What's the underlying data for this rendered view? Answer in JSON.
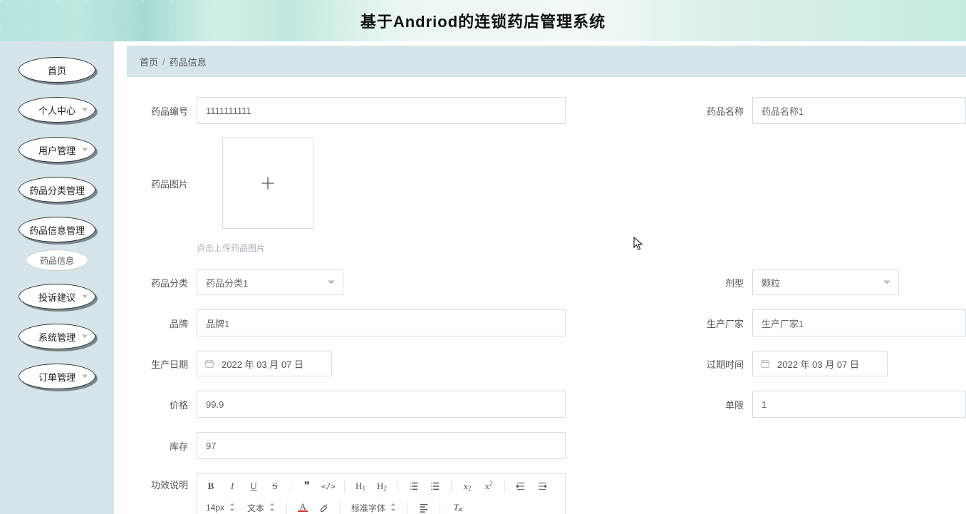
{
  "header": {
    "title": "基于Andriod的连锁药店管理系统"
  },
  "sidebar": {
    "items": [
      {
        "label": "首页",
        "caret": false
      },
      {
        "label": "个人中心",
        "caret": true
      },
      {
        "label": "用户管理",
        "caret": true
      },
      {
        "label": "药品分类管理",
        "caret": false
      },
      {
        "label": "药品信息管理",
        "caret": false
      },
      {
        "label": "投诉建议",
        "caret": true
      },
      {
        "label": "系统管理",
        "caret": true
      },
      {
        "label": "订单管理",
        "caret": true
      }
    ],
    "sublabel": "药品信息"
  },
  "breadcrumb": {
    "home": "首页",
    "sep": "/",
    "current": "药品信息"
  },
  "form": {
    "labels": {
      "code": "药品编号",
      "name": "药品名称",
      "image": "药品图片",
      "uploadHint": "点击上传药品图片",
      "category": "药品分类",
      "dosage": "剂型",
      "brand": "品牌",
      "manufacturer": "生产厂家",
      "produceDate": "生产日期",
      "expireDate": "过期时间",
      "price": "价格",
      "limit": "单限",
      "stock": "库存",
      "efficacy": "功效说明"
    },
    "values": {
      "code": "1111111111",
      "name": "药品名称1",
      "category": "药品分类1",
      "dosage": "颗粒",
      "brand": "品牌1",
      "manufacturer": "生产厂家1",
      "produceDate": "2022 年 03 月 07 日",
      "expireDate": "2022 年 03 月 07 日",
      "price": "99.9",
      "limit": "1",
      "stock": "97"
    }
  },
  "rte": {
    "fontSize": "14px",
    "fontType": "文本",
    "fontFamily": "标准字体"
  }
}
